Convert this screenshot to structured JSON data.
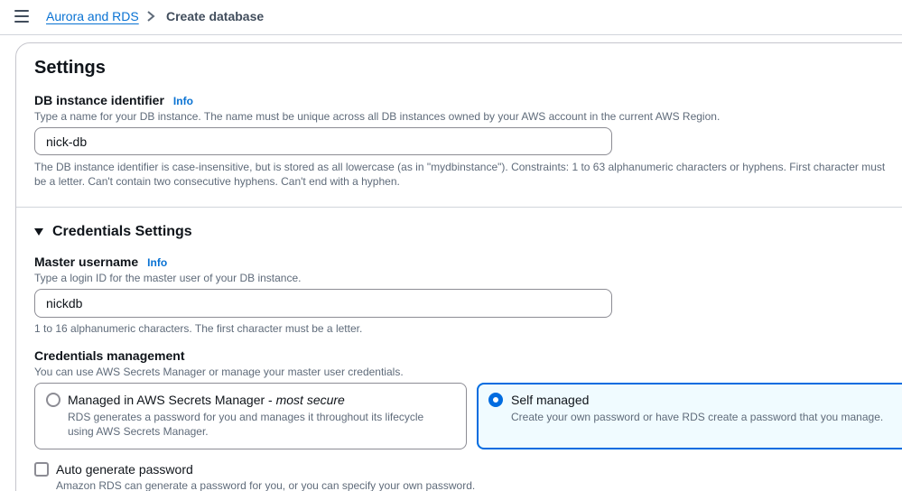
{
  "breadcrumb": {
    "menu_icon": "hamburger-menu-icon",
    "parent": "Aurora and RDS",
    "separator_icon": "chevron-right-icon",
    "current": "Create database"
  },
  "settings": {
    "heading": "Settings",
    "db_identifier": {
      "label": "DB instance identifier",
      "info": "Info",
      "description": "Type a name for your DB instance. The name must be unique across all DB instances owned by your AWS account in the current AWS Region.",
      "value": "nick-db",
      "constraint_line1": "The DB instance identifier is case-insensitive, but is stored as all lowercase (as in \"mydbinstance\"). Constraints: 1 to 63 alphanumeric characters or hyphens. First character must",
      "constraint_line2": "be a letter. Can't contain two consecutive hyphens. Can't end with a hyphen."
    }
  },
  "credentials": {
    "heading": "Credentials Settings",
    "expanded": true,
    "master_username": {
      "label": "Master username",
      "info": "Info",
      "description": "Type a login ID for the master user of your DB instance.",
      "value": "nickdb",
      "constraint": "1 to 16 alphanumeric characters. The first character must be a letter."
    },
    "management": {
      "label": "Credentials management",
      "description": "You can use AWS Secrets Manager or manage your master user credentials.",
      "options": [
        {
          "title": "Managed in AWS Secrets Manager - ",
          "title_emphasis": "most secure",
          "description_line1": "RDS generates a password for you and manages it throughout its lifecycle",
          "description_line2": "using AWS Secrets Manager.",
          "selected": false
        },
        {
          "title": "Self managed",
          "description_line1": "Create your own password or have RDS create a password that you manage.",
          "selected": true
        }
      ]
    },
    "auto_generate": {
      "label": "Auto generate password",
      "description": "Amazon RDS can generate a password for you, or you can specify your own password.",
      "checked": false
    }
  },
  "colors": {
    "link": "#0972d3",
    "selected_border": "#006ce0",
    "selected_bg": "#f0fbff"
  }
}
